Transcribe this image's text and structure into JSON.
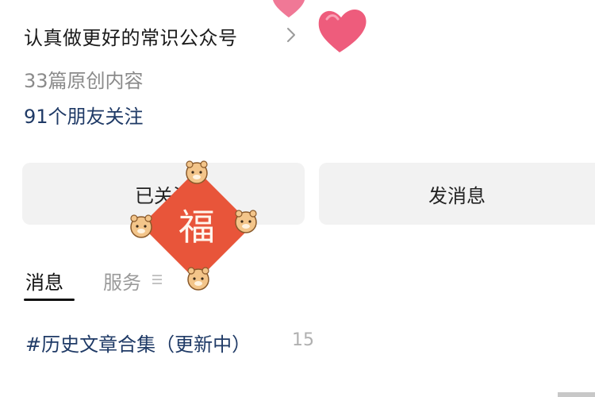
{
  "profile": {
    "account_name": "认真做更好的常识公众号",
    "article_count": "33篇原创内容",
    "follower_count": "91个朋友关注"
  },
  "actions": {
    "followed_label": "已关注",
    "message_label": "发消息"
  },
  "tabs": [
    {
      "label": "消息"
    },
    {
      "label": "服务"
    }
  ],
  "collection": {
    "title": "#历史文章合集（更新中）",
    "count": "15"
  },
  "sticker": {
    "character": "福"
  },
  "icons": {
    "chevron": "chevron-right-icon",
    "menu": "menu-lines-icon",
    "hearts": "heart-icon"
  },
  "colors": {
    "link_blue": "#1f3a66",
    "button_bg": "#f2f2f2",
    "sticker_red": "#e8553a",
    "heart_pink": "#ee5c7c"
  }
}
